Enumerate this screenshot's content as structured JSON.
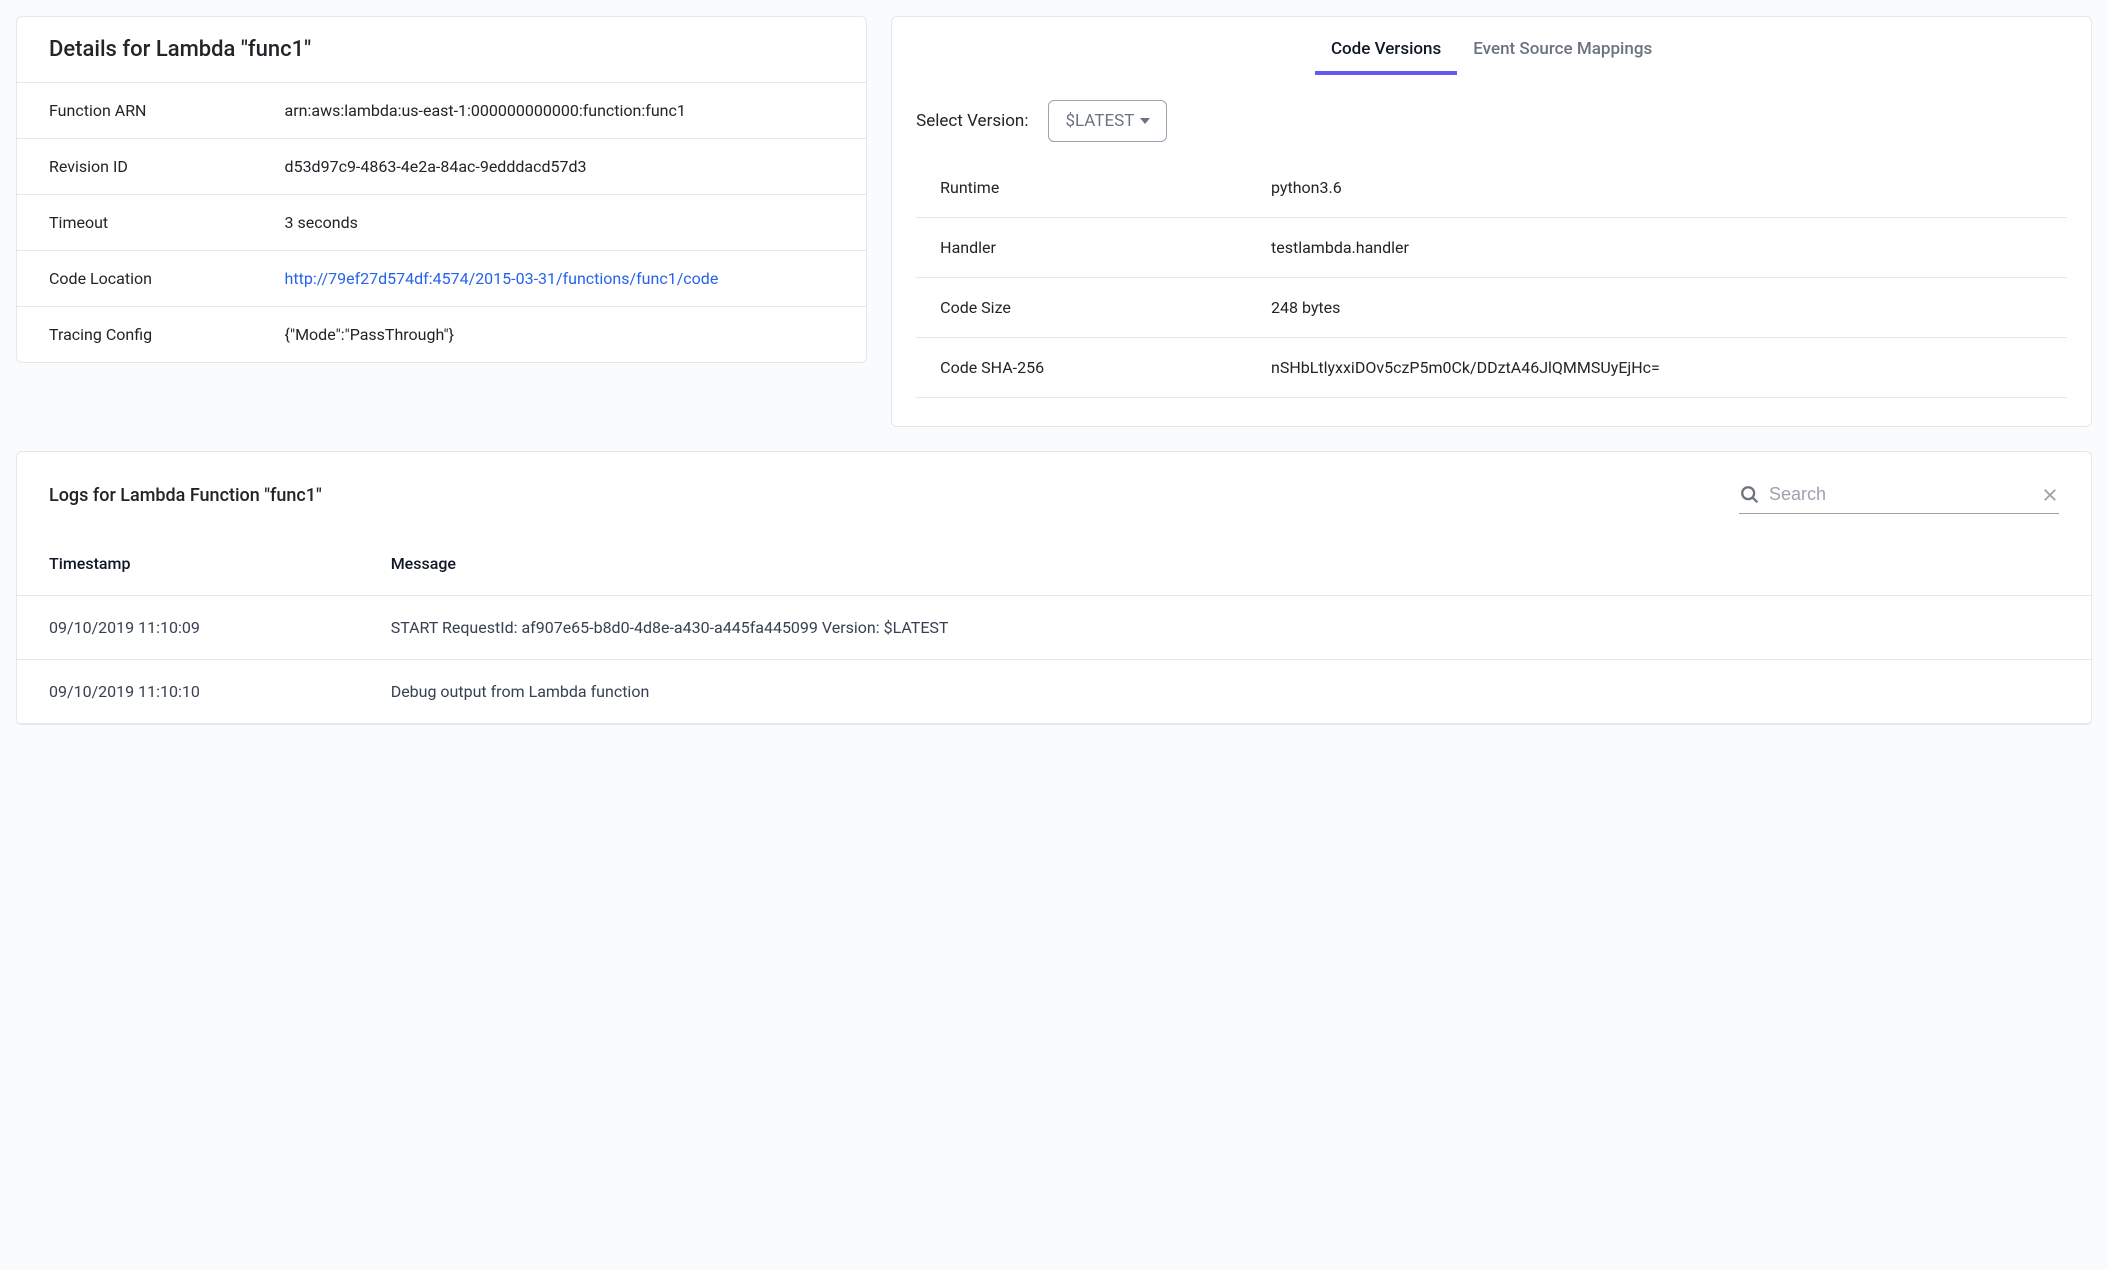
{
  "details": {
    "title": "Details for Lambda \"func1\"",
    "rows": [
      {
        "label": "Function ARN",
        "value": "arn:aws:lambda:us-east-1:000000000000:function:func1"
      },
      {
        "label": "Revision ID",
        "value": "d53d97c9-4863-4e2a-84ac-9edddacd57d3"
      },
      {
        "label": "Timeout",
        "value": "3 seconds"
      },
      {
        "label": "Code Location",
        "link": "http://79ef27d574df:4574/2015-03-31/functions/func1/code"
      },
      {
        "label": "Tracing Config",
        "value": "{\"Mode\":\"PassThrough\"}"
      }
    ]
  },
  "tabs": {
    "code_versions": "Code Versions",
    "event_source_mappings": "Event Source Mappings"
  },
  "version_select": {
    "label": "Select Version:",
    "selected": "$LATEST"
  },
  "version_details": [
    {
      "key": "Runtime",
      "value": "python3.6"
    },
    {
      "key": "Handler",
      "value": "testlambda.handler"
    },
    {
      "key": "Code Size",
      "value": "248 bytes"
    },
    {
      "key": "Code SHA-256",
      "value": "nSHbLtlyxxiDOv5czP5m0Ck/DDztA46JlQMMSUyEjHc="
    }
  ],
  "logs": {
    "title": "Logs for Lambda Function \"func1\"",
    "search_placeholder": "Search",
    "columns": {
      "timestamp": "Timestamp",
      "message": "Message"
    },
    "rows": [
      {
        "timestamp": "09/10/2019 11:10:09",
        "message": "START RequestId: af907e65-b8d0-4d8e-a430-a445fa445099 Version: $LATEST"
      },
      {
        "timestamp": "09/10/2019 11:10:10",
        "message": "Debug output from Lambda function"
      }
    ]
  }
}
